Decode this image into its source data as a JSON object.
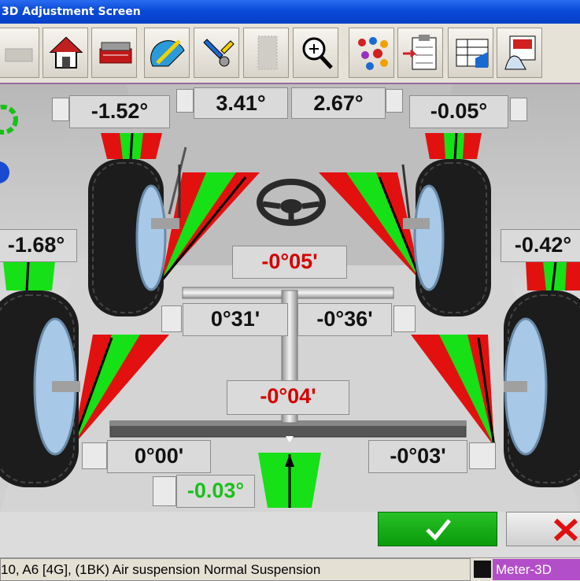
{
  "window": {
    "title": "3D Adjustment Screen"
  },
  "toolbar": {
    "buttons": [
      {
        "name": "disabled-tool-icon"
      },
      {
        "name": "home-icon"
      },
      {
        "name": "vehicle-specs-icon"
      },
      {
        "name": "angle-gauge-icon"
      },
      {
        "name": "wrench-adjust-icon"
      },
      {
        "name": "blank-tool-icon"
      },
      {
        "name": "zoom-icon"
      },
      {
        "name": "component-view-icon"
      },
      {
        "name": "clipboard-report-icon"
      },
      {
        "name": "table-data-icon"
      },
      {
        "name": "print-report-icon"
      }
    ]
  },
  "readings": {
    "front_left_camber": "-1.52°",
    "front_left_caster": "3.41°",
    "front_right_caster": "2.67°",
    "front_right_camber": "-0.05°",
    "rear_left_camber": "-1.68°",
    "rear_right_camber": "-0.42°",
    "steering_wheel": "-0°05'",
    "front_left_toe": "0°31'",
    "front_right_toe": "-0°36'",
    "thrust": "-0°04'",
    "rear_left_toe": "0°00'",
    "rear_right_toe": "-0°03'",
    "setback": "-0.03°"
  },
  "colors": {
    "accent_red": "#d40000",
    "accent_green": "#19c019",
    "status_purple": "#b24fc8"
  },
  "status": {
    "vehicle": "10, A6 [4G], (1BK) Air suspension Normal Suspension",
    "meter": "Meter-3D"
  }
}
